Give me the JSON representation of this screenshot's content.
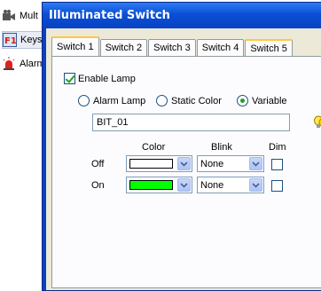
{
  "sidebar": {
    "items": [
      {
        "label": "Mult"
      },
      {
        "label": "Keys"
      },
      {
        "label": "Alarm"
      }
    ]
  },
  "dialog": {
    "title": "Illuminated Switch",
    "tabs": [
      "Switch 1",
      "Switch 2",
      "Switch 3",
      "Switch 4",
      "Switch 5"
    ],
    "active_tab": "Switch 1"
  },
  "lamp": {
    "enable_label": "Enable Lamp",
    "enable_checked": true,
    "mode_options": [
      "Alarm Lamp",
      "Static Color",
      "Variable"
    ],
    "selected_mode": "Variable",
    "variable_value": "BIT_01"
  },
  "grid": {
    "headers": {
      "color": "Color",
      "blink": "Blink",
      "dim": "Dim"
    },
    "rows": [
      {
        "label": "Off",
        "color": "#ffffff",
        "blink": "None",
        "dim": false
      },
      {
        "label": "On",
        "color": "#00ff00",
        "blink": "None",
        "dim": false
      }
    ]
  },
  "colors": {
    "title_bar": "#0a4fd6",
    "tab_highlight": "#ffc83c",
    "dialog_bg": "#ece9d8"
  }
}
